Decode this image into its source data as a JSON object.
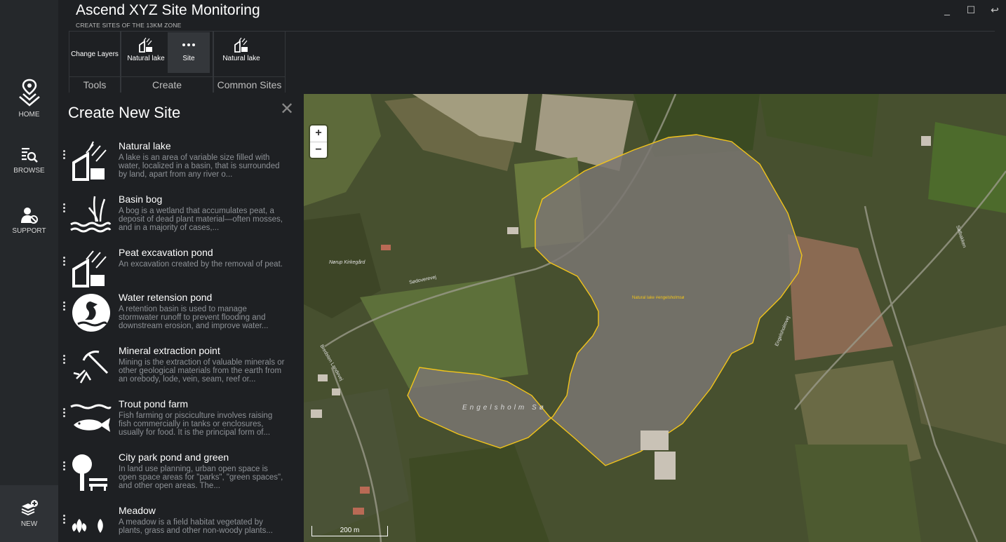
{
  "nav": {
    "home_label": "HOME",
    "browse_label": "BROWSE",
    "support_label": "SUPPORT",
    "new_label": "NEW"
  },
  "header": {
    "title": "Ascend XYZ Site Monitoring",
    "subtitle": "CREATE SITES OF THE 13KM ZONE"
  },
  "ribbon": {
    "tools": {
      "label": "Tools",
      "change_layers": "Change Layers"
    },
    "create": {
      "label": "Create",
      "natural_lake": "Natural lake",
      "site": "Site"
    },
    "common": {
      "label": "Common Sites",
      "natural_lake": "Natural lake"
    }
  },
  "panel": {
    "title": "Create New Site",
    "sites": [
      {
        "name": "Natural lake",
        "icon": "natural-lake-icon",
        "desc": "A lake is an area of variable size filled with water, localized in a basin, that is surrounded by land, apart from any river o..."
      },
      {
        "name": "Basin bog",
        "icon": "basin-bog-icon",
        "desc": "A bog is a wetland that accumulates peat, a deposit of dead plant material—often mosses, and in a majority of cases,..."
      },
      {
        "name": "Peat excavation pond",
        "icon": "peat-excavation-icon",
        "desc": "An excavation created by the removal of peat."
      },
      {
        "name": "Water retension pond",
        "icon": "heron-icon",
        "desc": "A retention basin is used to manage stormwater runoff to prevent flooding and downstream erosion, and improve water..."
      },
      {
        "name": "Mineral extraction point",
        "icon": "pickaxe-icon",
        "desc": "Mining is the extraction of valuable minerals or other geological materials from the earth from an orebody, lode, vein, seam, reef or..."
      },
      {
        "name": "Trout pond farm",
        "icon": "fish-icon",
        "desc": "Fish farming or pisciculture involves raising fish commercially in tanks or enclosures, usually for food. It is the principal form of..."
      },
      {
        "name": "City park pond and green",
        "icon": "tree-bench-icon",
        "desc": "In land use planning, urban open space is open space areas for \"parks\", \"green spaces\", and other open areas. The..."
      },
      {
        "name": "Meadow",
        "icon": "meadow-icon",
        "desc": "A meadow is a field habitat vegetated by plants, grass and other non-woody plants..."
      }
    ]
  },
  "map": {
    "lake_polygon_label": "Natural lake #engelsholmsø",
    "lake_name": "Engelsholm Sø",
    "places": [
      "Nørup Kirkegård",
      "Sødoverevej",
      "Engelsholmvej",
      "Sølbakken",
      "Bredsten Landevej"
    ],
    "scale_label": "200 m",
    "zoom_in": "+",
    "zoom_out": "−",
    "accent_color": "#f2c41a"
  },
  "window": {
    "minimize": "_",
    "maximize": "☐",
    "restore": "↩"
  }
}
